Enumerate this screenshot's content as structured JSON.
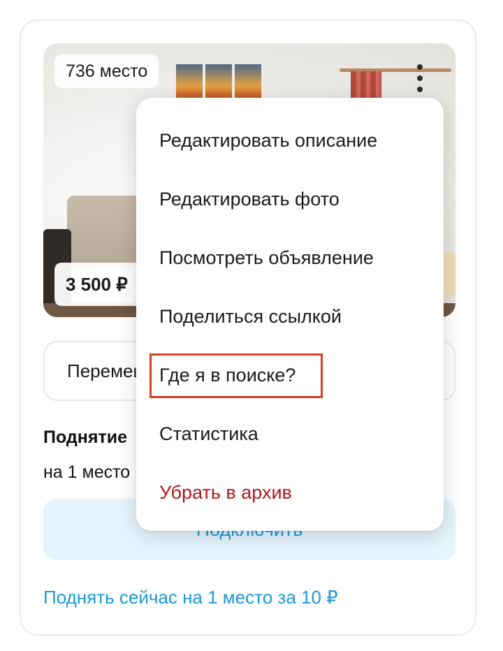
{
  "listing": {
    "place_badge": "736 место",
    "price_badge": "3 500 ₽"
  },
  "actions": {
    "move_label": "Перемещ",
    "raise_title": "Поднятие",
    "raise_subtitle": "на 1 место",
    "connect_label": "Подключить",
    "raise_now_link": "Поднять сейчас на 1 место за 10 ₽"
  },
  "menu": {
    "items": [
      {
        "label": "Редактировать описание"
      },
      {
        "label": "Редактировать фото"
      },
      {
        "label": "Посмотреть объявление"
      },
      {
        "label": "Поделиться ссылкой"
      },
      {
        "label": "Где я в поиске?"
      },
      {
        "label": "Статистика"
      },
      {
        "label": "Убрать в архив"
      }
    ]
  },
  "colors": {
    "accent": "#1a9ad6",
    "danger": "#b3161c",
    "highlight": "#d8401f"
  },
  "icons": {
    "more": "kebab-menu-icon"
  }
}
